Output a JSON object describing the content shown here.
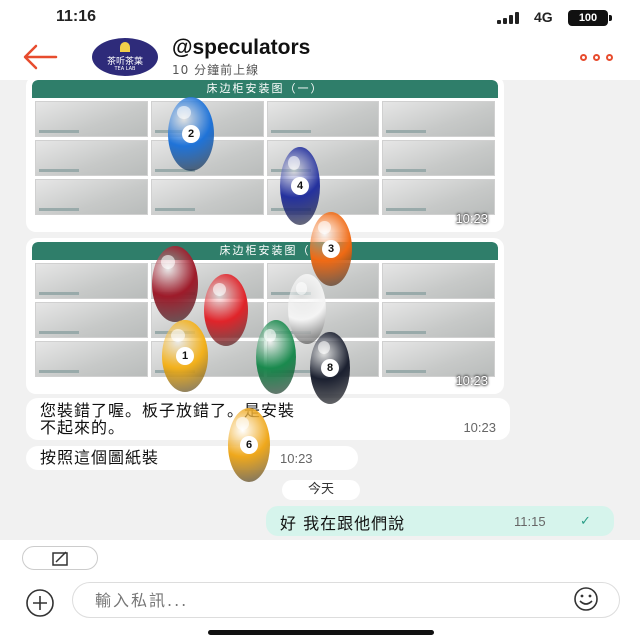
{
  "status_bar": {
    "time": "11:16",
    "network": "4G",
    "battery": "100"
  },
  "header": {
    "avatar_text_top": "茶听茶葉",
    "avatar_text_bottom": "TEA LAB",
    "title": "@speculators",
    "subtitle": "10 分鐘前上線"
  },
  "messages": {
    "image1": {
      "title": "床边柜安装图（一）",
      "time": "10:23"
    },
    "image2": {
      "title": "床边柜安装图（",
      "time": "10:23"
    },
    "text1": {
      "line1": "您裝錯了喔。板子放錯了。是安裝",
      "line2": "不起來的。",
      "time": "10:23"
    },
    "text2": {
      "text": "按照這個圖紙裝",
      "time": "10:23"
    },
    "date_divider": "今天",
    "outgoing": {
      "text": "好 我在跟他們說",
      "time": "11:15"
    }
  },
  "balls": [
    {
      "number": "2",
      "color": "#1f73d8"
    },
    {
      "number": "4",
      "color": "#24319e"
    },
    {
      "number": "3",
      "color": "#f06a14"
    },
    {
      "number": "",
      "color": "#9e1b2a"
    },
    {
      "number": "",
      "color": "#e0242a"
    },
    {
      "number": "",
      "color": "#f4f4f4"
    },
    {
      "number": "1",
      "color": "#f3b11c"
    },
    {
      "number": "",
      "color": "#1a8a4e"
    },
    {
      "number": "8",
      "color": "#1b2030"
    },
    {
      "number": "6",
      "color": "#efa81c"
    }
  ],
  "composer": {
    "placeholder": "輸入私訊..."
  },
  "colors": {
    "accent": "#e74c2e",
    "outgoing_bubble": "#d6f4ec",
    "banner_green": "#2f7e6a"
  }
}
